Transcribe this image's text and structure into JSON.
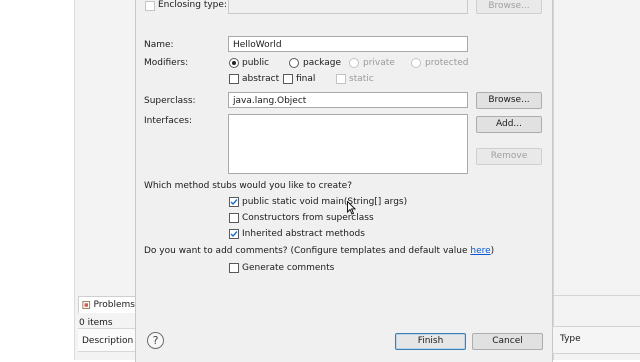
{
  "dialog": {
    "enclosing_type_label": "Enclosing type:",
    "browse_enclosing_label": "Browse...",
    "name_label": "Name:",
    "name_value": "HelloWorld",
    "modifiers_label": "Modifiers:",
    "modifiers": {
      "public": "public",
      "package": "package",
      "private": "private",
      "protected": "protected",
      "abstract": "abstract",
      "final": "final",
      "static": "static"
    },
    "superclass_label": "Superclass:",
    "superclass_value": "java.lang.Object",
    "browse_superclass_label": "Browse...",
    "interfaces_label": "Interfaces:",
    "add_label": "Add...",
    "remove_label": "Remove",
    "method_stubs_question": "Which method stubs would you like to create?",
    "stubs": {
      "main": "public static void main(String[] args)",
      "constructors": "Constructors from superclass",
      "inherited": "Inherited abstract methods"
    },
    "comments_question_prefix": "Do you want to add comments? (Configure templates and default value ",
    "comments_link": "here",
    "comments_question_suffix": ")",
    "generate_comments": "Generate comments",
    "finish_label": "Finish",
    "cancel_label": "Cancel",
    "help_glyph": "?"
  },
  "ide": {
    "problems_tab": "Problems",
    "items_count": "0 items",
    "description_header": "Description",
    "type_header": "Type"
  },
  "icons": {
    "help": "help-icon",
    "problems": "problems-icon",
    "checkmark": "check-icon"
  },
  "colors": {
    "link": "#0b57d0",
    "dialog_bg": "#f0f0f0",
    "default_button_border": "#3c7fb1"
  }
}
